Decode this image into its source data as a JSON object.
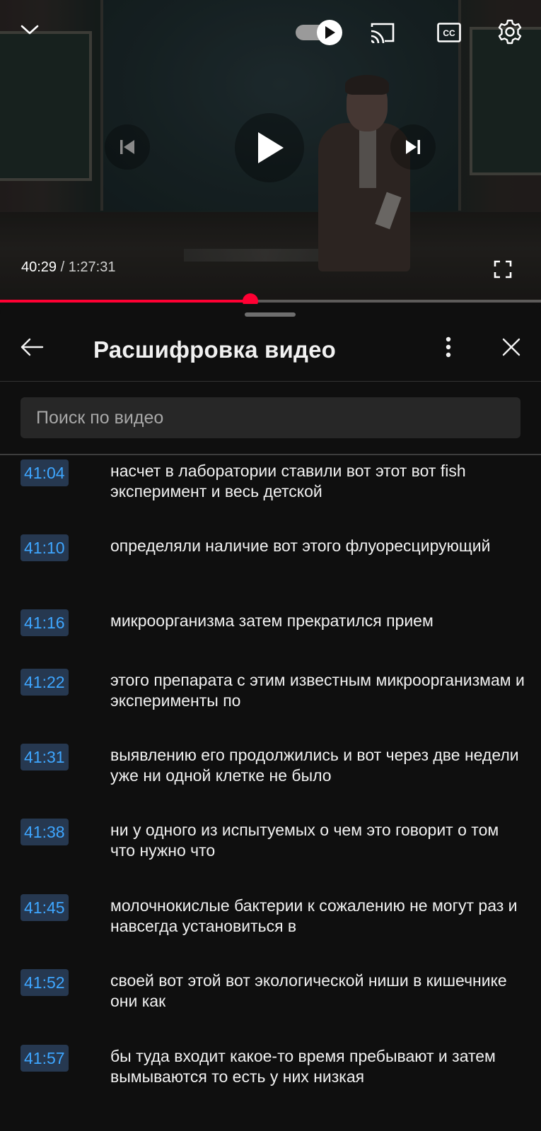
{
  "player": {
    "current_time": "40:29",
    "separator": "/",
    "duration": "1:27:31",
    "progress_fraction": 0.4626,
    "autoplay_on": true,
    "icons": {
      "minimize": "chevron-down-icon",
      "autoplay": "autoplay-toggle-icon",
      "cast": "cast-icon",
      "captions": "cc-icon",
      "settings": "gear-icon",
      "previous": "skip-previous-icon",
      "play": "play-icon",
      "next": "skip-next-icon",
      "fullscreen": "fullscreen-icon"
    },
    "accent_color": "#ff0033"
  },
  "transcript_panel": {
    "title": "Расшифровка видео",
    "search_placeholder": "Поиск по видео",
    "icons": {
      "back": "arrow-left-icon",
      "more": "more-vertical-icon",
      "close": "close-icon"
    },
    "timestamp_color": "#3ea6ff",
    "segments": [
      {
        "time": "41:04",
        "text": "насчет в лаборатории ставили вот этот вот fish эксперимент и весь детской"
      },
      {
        "time": "41:10",
        "text": "определяли наличие вот этого флуоресцирующий"
      },
      {
        "time": "41:16",
        "text": "микроорганизма затем прекратился прием"
      },
      {
        "time": "41:22",
        "text": "этого препарата с этим известным микроорганизмам и эксперименты по"
      },
      {
        "time": "41:31",
        "text": "выявлению его продолжились и вот через две недели уже ни одной клетке не было"
      },
      {
        "time": "41:38",
        "text": "ни у одного из испытуемых о чем это говорит о том что нужно что"
      },
      {
        "time": "41:45",
        "text": "молочнокислые бактерии к сожалению не могут раз и навсегда установиться в"
      },
      {
        "time": "41:52",
        "text": "своей вот этой вот экологической ниши в кишечнике они как"
      },
      {
        "time": "41:57",
        "text": "бы туда входит какое-то время пребывают и затем вымываются то есть у них низкая"
      }
    ]
  }
}
